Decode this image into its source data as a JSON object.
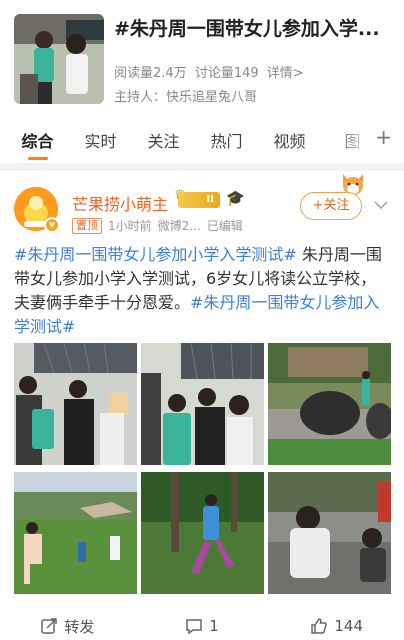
{
  "topic": {
    "title": "#朱丹周一围带女儿参加入学...",
    "reads": "阅读量2.4万",
    "discussions": "讨论量149",
    "details": "详情>",
    "host": "主持人：快乐追星兔八哥"
  },
  "tabs": [
    "综合",
    "实时",
    "关注",
    "热门",
    "视频",
    "图"
  ],
  "tab_add": "+",
  "post": {
    "username": "芒果捞小萌主",
    "level": "II",
    "top_tag": "置顶",
    "time": "1小时前",
    "source": "微博2...",
    "edited": "已编辑",
    "follow": "+关注",
    "text_parts": [
      {
        "type": "tag",
        "text": "#朱丹周一围带女儿参加小学入学测试#"
      },
      {
        "type": "plain",
        "text": " 朱丹周一围带女儿参加小学入学测试，6岁女儿将读公立学校，夫妻俩手牵手十分恩爱。"
      },
      {
        "type": "tag",
        "text": "#朱丹周一围带女儿参加入学测试#"
      }
    ]
  },
  "footer": {
    "repost": "转发",
    "comments": "1",
    "likes": "144"
  },
  "colors": {
    "accent": "#ff8200",
    "username": "#f0641e",
    "hashtag": "#3e7fd6"
  }
}
